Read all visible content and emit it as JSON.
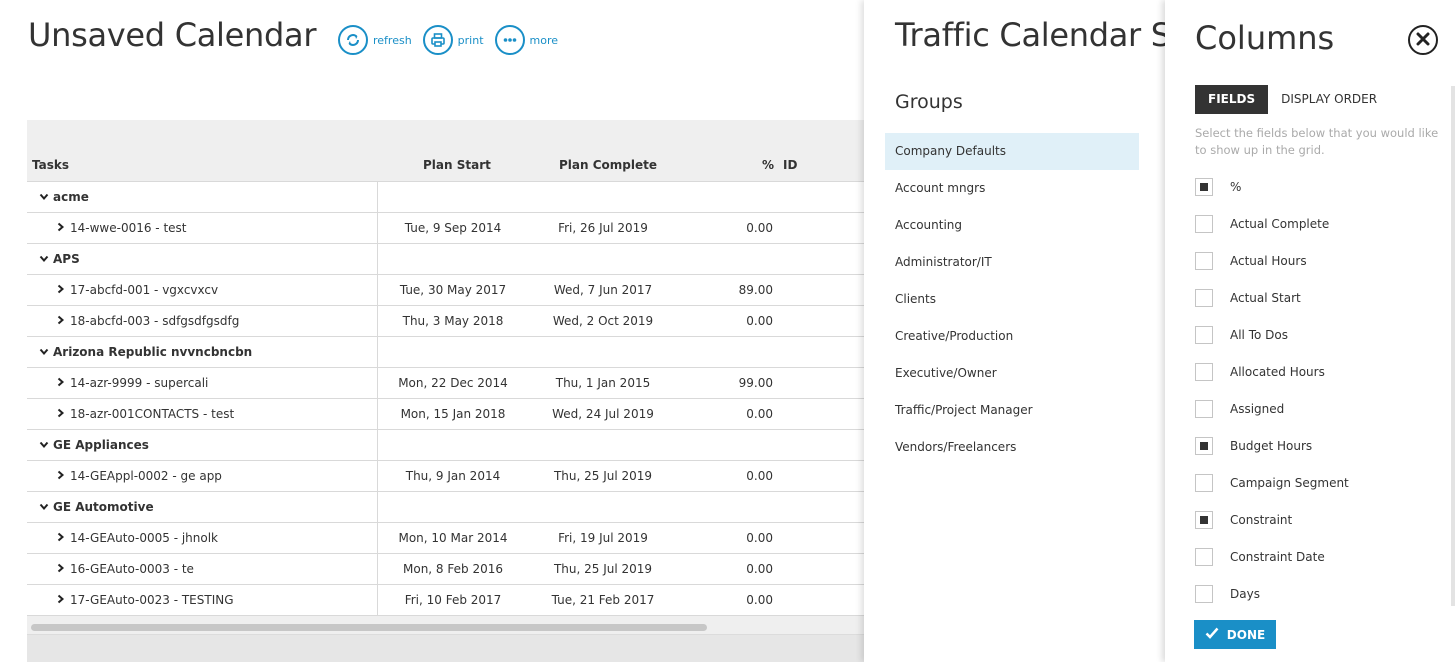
{
  "calendar": {
    "title": "Unsaved Calendar",
    "toolbar": [
      {
        "label": "refresh",
        "icon": "refresh-icon"
      },
      {
        "label": "print",
        "icon": "print-icon"
      },
      {
        "label": "more",
        "icon": "more-icon"
      }
    ],
    "columns": {
      "tasks": "Tasks",
      "plan_start": "Plan Start",
      "plan_complete": "Plan Complete",
      "pct": "%",
      "id": "ID"
    },
    "rows": [
      {
        "type": "group",
        "label": "acme"
      },
      {
        "type": "task",
        "label": "14-wwe-0016 - test",
        "start": "Tue, 9 Sep 2014",
        "complete": "Fri, 26 Jul 2019",
        "pct": "0.00"
      },
      {
        "type": "group",
        "label": "APS"
      },
      {
        "type": "task",
        "label": "17-abcfd-001 - vgxcvxcv",
        "start": "Tue, 30 May 2017",
        "complete": "Wed, 7 Jun 2017",
        "pct": "89.00"
      },
      {
        "type": "task",
        "label": "18-abcfd-003 - sdfgsdfgsdfg",
        "start": "Thu, 3 May 2018",
        "complete": "Wed, 2 Oct 2019",
        "pct": "0.00"
      },
      {
        "type": "group",
        "label": "Arizona Republic nvvncbncbn"
      },
      {
        "type": "task",
        "label": "14-azr-9999 - supercali",
        "start": "Mon, 22 Dec 2014",
        "complete": "Thu, 1 Jan 2015",
        "pct": "99.00"
      },
      {
        "type": "task",
        "label": "18-azr-001CONTACTS - test",
        "start": "Mon, 15 Jan 2018",
        "complete": "Wed, 24 Jul 2019",
        "pct": "0.00"
      },
      {
        "type": "group",
        "label": "GE Appliances"
      },
      {
        "type": "task",
        "label": "14-GEAppl-0002 - ge app",
        "start": "Thu, 9 Jan 2014",
        "complete": "Thu, 25 Jul 2019",
        "pct": "0.00"
      },
      {
        "type": "group",
        "label": "GE Automotive"
      },
      {
        "type": "task",
        "label": "14-GEAuto-0005 - jhnolk",
        "start": "Mon, 10 Mar 2014",
        "complete": "Fri, 19 Jul 2019",
        "pct": "0.00"
      },
      {
        "type": "task",
        "label": "16-GEAuto-0003 - te",
        "start": "Mon, 8 Feb 2016",
        "complete": "Thu, 25 Jul 2019",
        "pct": "0.00"
      },
      {
        "type": "task",
        "label": "17-GEAuto-0023 - TESTING",
        "start": "Fri, 10 Feb 2017",
        "complete": "Tue, 21 Feb 2017",
        "pct": "0.00"
      }
    ]
  },
  "settings": {
    "title": "Traffic Calendar S",
    "groups_heading": "Groups",
    "groups": [
      {
        "label": "Company Defaults",
        "active": true
      },
      {
        "label": "Account mngrs",
        "active": false
      },
      {
        "label": "Accounting",
        "active": false
      },
      {
        "label": "Administrator/IT",
        "active": false
      },
      {
        "label": "Clients",
        "active": false
      },
      {
        "label": "Creative/Production",
        "active": false
      },
      {
        "label": "Executive/Owner",
        "active": false
      },
      {
        "label": "Traffic/Project Manager",
        "active": false
      },
      {
        "label": "Vendors/Freelancers",
        "active": false
      }
    ]
  },
  "columns_panel": {
    "title": "Columns",
    "tabs": [
      {
        "label": "FIELDS",
        "active": true
      },
      {
        "label": "DISPLAY ORDER",
        "active": false
      }
    ],
    "help": "Select the fields below that you would like to show up in the grid.",
    "fields": [
      {
        "label": "%",
        "checked": true
      },
      {
        "label": "Actual Complete",
        "checked": false
      },
      {
        "label": "Actual Hours",
        "checked": false
      },
      {
        "label": "Actual Start",
        "checked": false
      },
      {
        "label": "All To Dos",
        "checked": false
      },
      {
        "label": "Allocated Hours",
        "checked": false
      },
      {
        "label": "Assigned",
        "checked": false
      },
      {
        "label": "Budget Hours",
        "checked": true
      },
      {
        "label": "Campaign Segment",
        "checked": false
      },
      {
        "label": "Constraint",
        "checked": true
      },
      {
        "label": "Constraint Date",
        "checked": false
      },
      {
        "label": "Days",
        "checked": false
      }
    ],
    "done_label": "DONE"
  },
  "colors": {
    "accent": "#1a8fc7",
    "dark": "#333333",
    "active_group": "#e0f0f8"
  }
}
